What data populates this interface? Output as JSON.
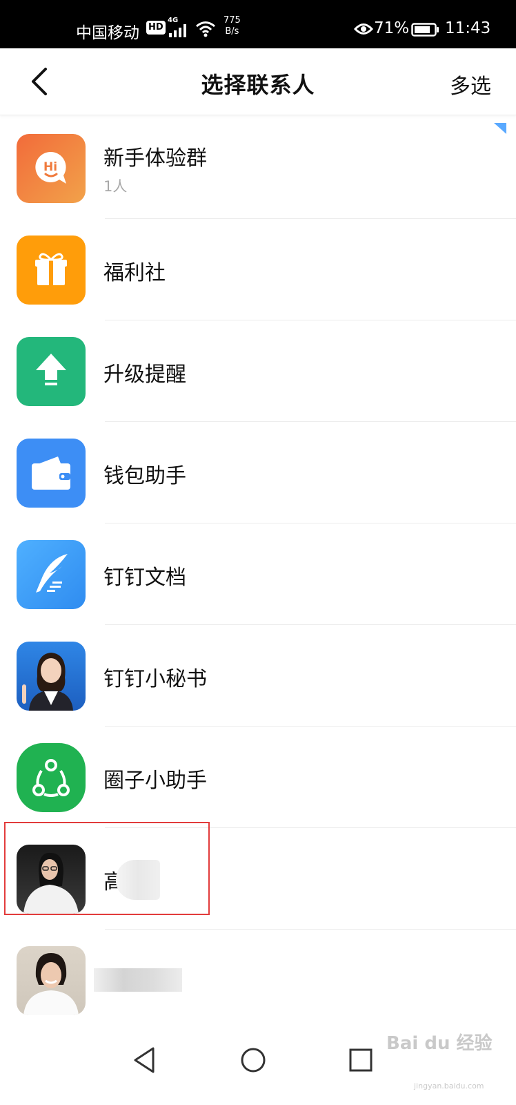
{
  "status_bar": {
    "carrier": "中国移动",
    "hd_badge": "HD",
    "network": "4G",
    "speed_value": "775",
    "speed_unit": "B/s",
    "battery_percent": "71%",
    "time": "11:43"
  },
  "header": {
    "title": "选择联系人",
    "multi_select_label": "多选"
  },
  "contacts": [
    {
      "name": "新手体验群",
      "subtitle": "1人",
      "icon": "hi-chat-bubble-icon",
      "color": "#f07a3c"
    },
    {
      "name": "福利社",
      "icon": "gift-icon",
      "color": "#ff9d0a"
    },
    {
      "name": "升级提醒",
      "icon": "upload-arrow-icon",
      "color": "#23b77b"
    },
    {
      "name": "钱包助手",
      "icon": "wallet-icon",
      "color": "#3d8ef5"
    },
    {
      "name": "钉钉文档",
      "icon": "feather-pen-icon",
      "color": "#3aa1f8"
    },
    {
      "name": "钉钉小秘书",
      "icon": "assistant-avatar",
      "color": "#2e7ee0"
    },
    {
      "name": "圈子小助手",
      "icon": "circle-nodes-icon",
      "color": "#20b251"
    },
    {
      "name": "高",
      "icon": "user-avatar"
    },
    {
      "name": "",
      "icon": "user-avatar"
    }
  ],
  "watermark": {
    "text": "Bai du 经验",
    "url": "jingyan.baidu.com"
  }
}
